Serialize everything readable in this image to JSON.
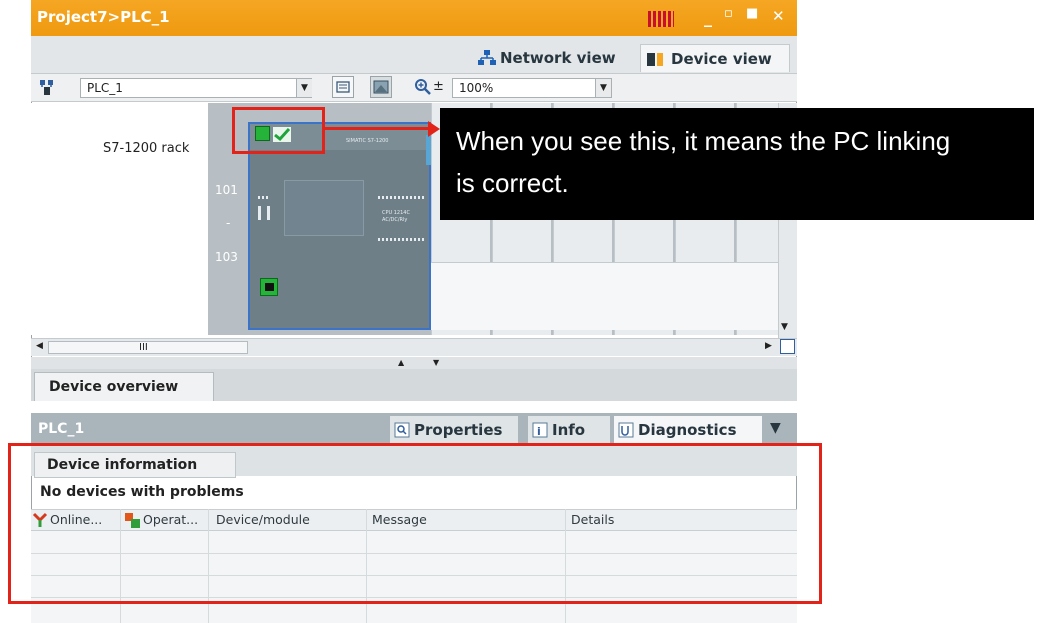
{
  "window": {
    "title": "Project7>PLC_1",
    "controls": [
      "_",
      "▫",
      "■",
      "✕"
    ]
  },
  "view_tabs": {
    "network_view": "Network view",
    "device_view": "Device view",
    "active": "Device view"
  },
  "toolbar": {
    "device_select": "PLC_1",
    "zoom_value": "100%",
    "zoom_pm": "±"
  },
  "rack": {
    "label": "S7-1200 rack",
    "slot_numbers": [
      "101",
      "-",
      "103"
    ],
    "plc_brand": "SIMATIC S7-1200",
    "plc_model": "CPU 1214C AC/DC/Rly"
  },
  "scrollbar": {
    "thumb_marker": "III"
  },
  "device_overview": {
    "tab_label": "Device overview"
  },
  "inspector": {
    "title": "PLC_1",
    "tabs": [
      "Properties",
      "Info",
      "Diagnostics"
    ],
    "active_tab": "Diagnostics"
  },
  "diagnostics": {
    "sub_tab": "Device information",
    "status_message": "No devices with problems",
    "columns": [
      "Online...",
      "Operat...",
      "Device/module",
      "Message",
      "Details"
    ]
  },
  "annotation": {
    "callout_line1": "When you see this, it means the PC linking",
    "callout_line2": "is correct.",
    "color": "#e2231a"
  },
  "colors": {
    "title_bar": "#f5a623",
    "online_ok": "#25b33a"
  }
}
